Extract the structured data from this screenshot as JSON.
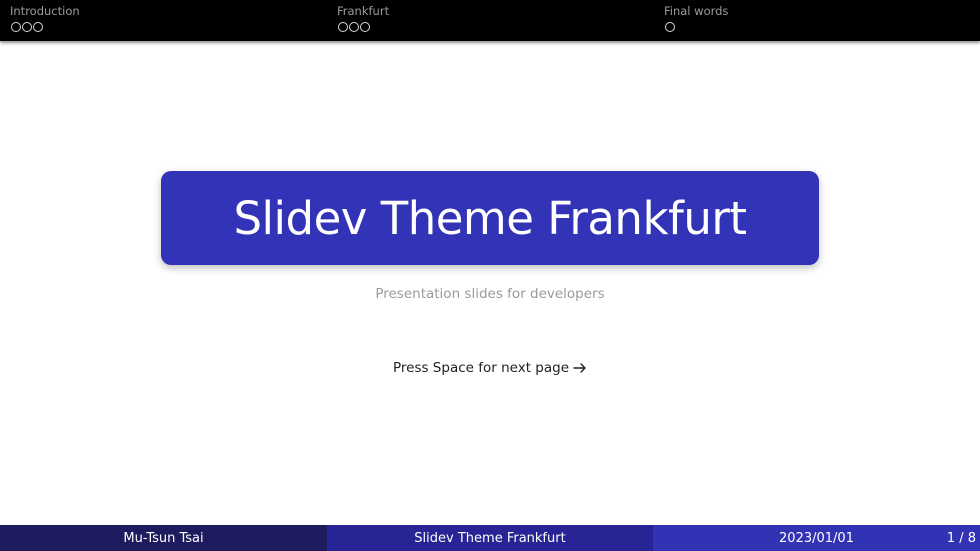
{
  "nav": {
    "sections": [
      {
        "label": "Introduction",
        "dots": 3
      },
      {
        "label": "Frankfurt",
        "dots": 3
      },
      {
        "label": "Final words",
        "dots": 1
      }
    ]
  },
  "slide": {
    "title": "Slidev Theme Frankfurt",
    "subtitle": "Presentation slides for developers",
    "next_hint": "Press Space for next page",
    "next_icon": "arrow-right-icon"
  },
  "footer": {
    "author": "Mu-Tsun Tsai",
    "title": "Slidev Theme Frankfurt",
    "date": "2023/01/01",
    "page": "1 / 8"
  },
  "colors": {
    "title_bg": "#3333b8",
    "footer_author_bg": "#1e1b5e",
    "footer_title_bg": "#272496",
    "footer_date_bg": "#3232b5"
  }
}
